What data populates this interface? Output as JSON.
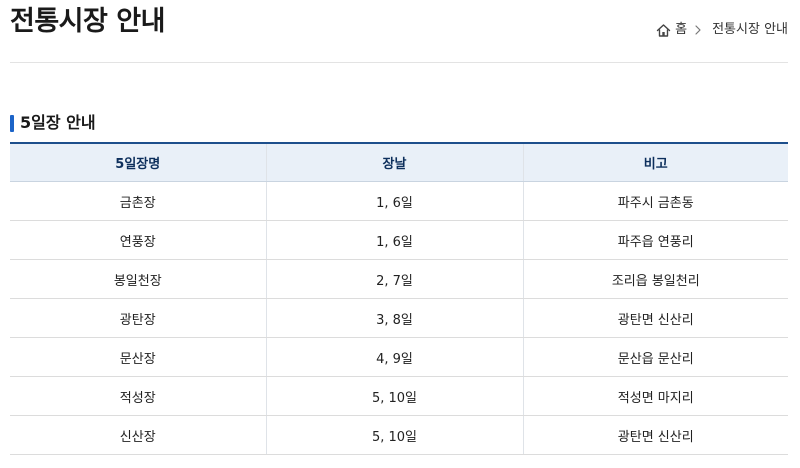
{
  "page": {
    "title": "전통시장 안내"
  },
  "breadcrumb": {
    "home_label": "홈",
    "current": "전통시장 안내"
  },
  "section": {
    "title": "5일장 안내"
  },
  "table": {
    "headers": [
      "5일장명",
      "장날",
      "비고"
    ],
    "rows": [
      [
        "금촌장",
        "1, 6일",
        "파주시 금촌동"
      ],
      [
        "연풍장",
        "1, 6일",
        "파주읍 연풍리"
      ],
      [
        "봉일천장",
        "2, 7일",
        "조리읍 봉일천리"
      ],
      [
        "광탄장",
        "3, 8일",
        "광탄면 신산리"
      ],
      [
        "문산장",
        "4, 9일",
        "문산읍 문산리"
      ],
      [
        "적성장",
        "5, 10일",
        "적성면 마지리"
      ],
      [
        "신산장",
        "5, 10일",
        "광탄면 신산리"
      ]
    ]
  },
  "colors": {
    "accent": "#1c64c8",
    "table_header_bg": "#e9f0f8",
    "table_header_text": "#0d2f5c",
    "table_top_border": "#1d4f8c"
  },
  "icons": {
    "home": "home-icon",
    "separator": "chevron-right-icon"
  }
}
